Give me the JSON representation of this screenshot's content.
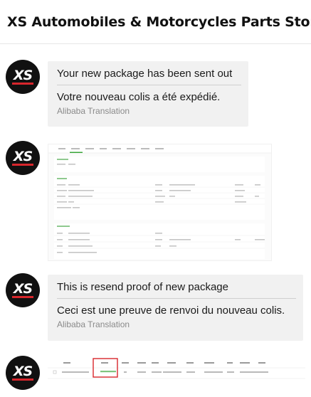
{
  "store": {
    "title": "XS Automobiles & Motorcycles Parts Store"
  },
  "avatar": {
    "logo_text": "XS"
  },
  "messages": [
    {
      "type": "text",
      "original": "Your new package has been sent out",
      "translated": "Votre nouveau colis a été expédié.",
      "source": "Alibaba Translation"
    },
    {
      "type": "image"
    },
    {
      "type": "text",
      "original": "This is resend proof of new package",
      "translated": "Ceci est une preuve de renvoi du nouveau colis.",
      "source": "Alibaba Translation"
    },
    {
      "type": "image"
    }
  ],
  "colors": {
    "highlight_box": "#d8262c",
    "tab_active": "#3aa53a"
  }
}
